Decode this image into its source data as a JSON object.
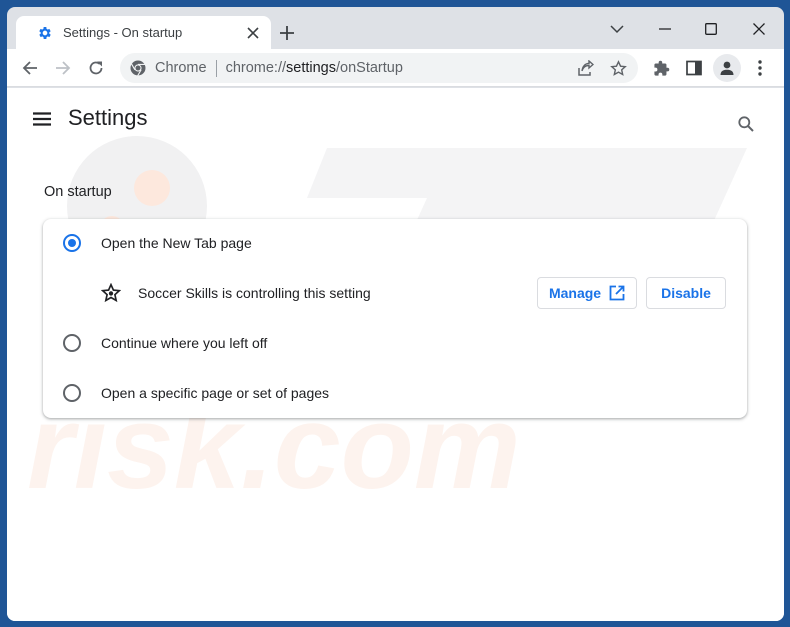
{
  "browser": {
    "tab": {
      "title": "Settings - On startup",
      "favicon": "gear-icon",
      "close_icon": "close-icon"
    },
    "new_tab_icon": "plus-icon",
    "window_controls": [
      "chevron-down-icon",
      "minimize-icon",
      "maximize-icon",
      "close-icon"
    ],
    "toolbar": {
      "back_icon": "arrow-left-icon",
      "forward_icon": "arrow-right-icon",
      "reload_icon": "reload-icon",
      "omnibox": {
        "site_chip": "Chrome",
        "url_prefix": "chrome://",
        "url_host": "settings",
        "url_path": "/onStartup"
      },
      "actions": [
        "share-icon",
        "star-icon",
        "extensions-icon",
        "side-panel-icon",
        "profile-icon",
        "more-icon"
      ]
    }
  },
  "settings": {
    "title": "Settings",
    "menu_icon": "hamburger-icon",
    "search_icon": "search-icon",
    "section": {
      "title": "On startup",
      "options": [
        {
          "label": "Open the New Tab page",
          "checked": true
        },
        {
          "label": "Continue where you left off",
          "checked": false
        },
        {
          "label": "Open a specific page or set of pages",
          "checked": false
        }
      ],
      "extension_notice": {
        "icon": "soccer-star-icon",
        "text": "Soccer Skills is controlling this setting",
        "manage_label": "Manage",
        "disable_label": "Disable"
      }
    }
  },
  "colors": {
    "accent": "#1a73e8",
    "frame": "#1f5596",
    "tabstrip": "#dee1e6"
  },
  "watermark": {
    "text": "risk.com"
  }
}
